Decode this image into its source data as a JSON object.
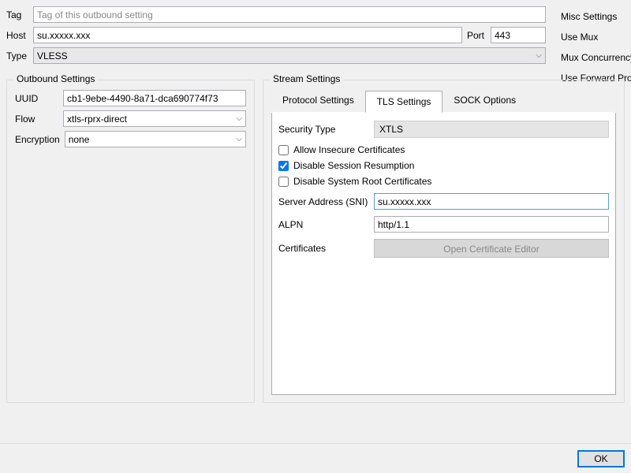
{
  "top": {
    "tag_label": "Tag",
    "tag_placeholder": "Tag of this outbound setting",
    "tag_value": "",
    "host_label": "Host",
    "host_value": "su.xxxxx.xxx",
    "port_label": "Port",
    "port_value": "443",
    "type_label": "Type",
    "type_value": "VLESS"
  },
  "sidemenu": {
    "items": [
      "Misc Settings",
      "Use Mux",
      "Mux Concurrency",
      "Use Forward Proxy"
    ]
  },
  "outbound": {
    "title": "Outbound Settings",
    "uuid_label": "UUID",
    "uuid_value": "cb1-9ebe-4490-8a71-dca690774f73",
    "flow_label": "Flow",
    "flow_value": "xtls-rprx-direct",
    "encryption_label": "Encryption",
    "encryption_value": "none"
  },
  "stream": {
    "title": "Stream Settings",
    "tabs": [
      "Protocol Settings",
      "TLS Settings",
      "SOCK Options"
    ],
    "tls": {
      "security_type_label": "Security Type",
      "security_type_value": "XTLS",
      "allow_insecure_label": "Allow Insecure Certificates",
      "allow_insecure_checked": false,
      "disable_session_label": "Disable Session Resumption",
      "disable_session_checked": true,
      "disable_system_root_label": "Disable System Root Certificates",
      "disable_system_root_checked": false,
      "sni_label": "Server Address (SNI)",
      "sni_value": "su.xxxxx.xxx",
      "alpn_label": "ALPN",
      "alpn_value": "http/1.1",
      "certificates_label": "Certificates",
      "cert_button_label": "Open Certificate Editor"
    }
  },
  "buttons": {
    "ok": "OK"
  }
}
